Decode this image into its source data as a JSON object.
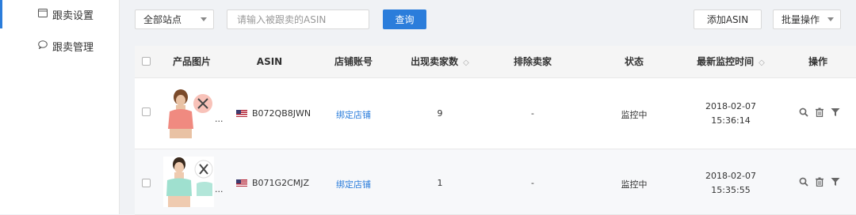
{
  "sidebar": {
    "items": [
      {
        "label": "跟卖设置",
        "icon": "window-icon",
        "active": true
      },
      {
        "label": "跟卖管理",
        "icon": "chat-icon",
        "active": false
      }
    ]
  },
  "toolbar": {
    "site_select": "全部站点",
    "asin_placeholder": "请输入被跟卖的ASIN",
    "query_label": "查询",
    "add_asin_label": "添加ASIN",
    "batch_label": "批量操作"
  },
  "table": {
    "headers": {
      "image": "产品图片",
      "asin": "ASIN",
      "store": "店铺账号",
      "sellers": "出现卖家数",
      "exclude": "排除卖家",
      "status": "状态",
      "monitor_time": "最新监控时间",
      "actions": "操作"
    },
    "rows": [
      {
        "asin": "B072QB8JWN",
        "store": "绑定店铺",
        "sellers": "9",
        "exclude": "-",
        "status": "监控中",
        "date": "2018-02-07",
        "time": "15:36:14",
        "more": "..."
      },
      {
        "asin": "B071G2CMJZ",
        "store": "绑定店铺",
        "sellers": "1",
        "exclude": "-",
        "status": "监控中",
        "date": "2018-02-07",
        "time": "15:35:55",
        "more": "..."
      }
    ]
  },
  "colors": {
    "accent": "#2b7ddb",
    "product1": "#f08a80",
    "product2": "#9fe0cf"
  }
}
